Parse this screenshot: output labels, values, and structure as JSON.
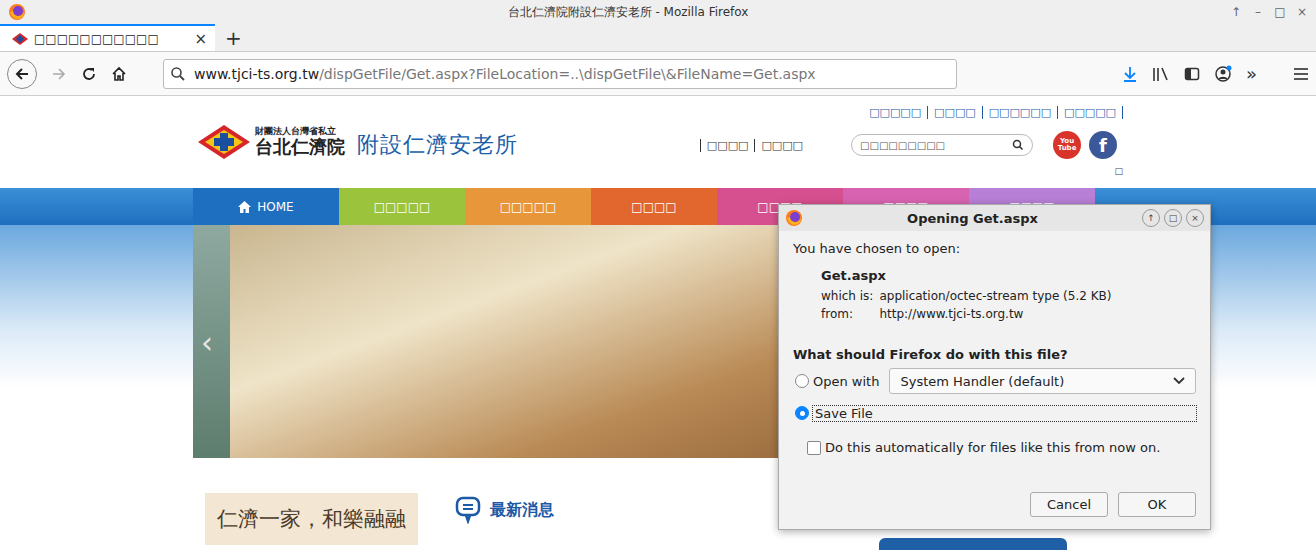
{
  "window": {
    "title": "台北仁濟院附設仁濟安老所 - Mozilla Firefox",
    "controls": [
      "↑",
      "–",
      "□",
      "×"
    ]
  },
  "tabs": [
    {
      "label": "□□□□□□□□□□□",
      "selected": true,
      "close": "×"
    }
  ],
  "new_tab": "+",
  "address_bar": {
    "host": "www.tjci-ts.org.tw",
    "path": "/dispGetFile/Get.aspx?FileLocation=..\\dispGetFile\\&FileName=Get.aspx"
  },
  "toolbar": {
    "overflow": "»"
  },
  "page": {
    "top_links": [
      "□□□□□",
      "□□□□",
      "□□□□□□",
      "□□□□□"
    ],
    "sub_links": [
      "□□□□",
      "□□□□"
    ],
    "search": {
      "placeholder": "□□□□□□□□□"
    },
    "logo": {
      "org": "財團法人台灣省私立",
      "name": "台北仁濟院",
      "subtitle": "附設仁濟安老所"
    },
    "social": {
      "youtube": "You Tube",
      "facebook": "f"
    },
    "corner_box": "□",
    "nav": [
      {
        "label": "HOME",
        "color": "#1f6fc0"
      },
      {
        "label": "□□□□□",
        "color": "#9bc43c"
      },
      {
        "label": "□□□□□",
        "color": "#e8963a"
      },
      {
        "label": "□□□□",
        "color": "#e2672e"
      },
      {
        "label": "□□□□",
        "color": "#d6508f"
      },
      {
        "label": "□□□□",
        "color": "#d763b0"
      },
      {
        "label": "□□□□",
        "color": "#b77fd6"
      }
    ],
    "carousel_prev": "‹",
    "slogan": "仁濟一家，和樂融融",
    "news_title": "最新消息"
  },
  "dialog": {
    "title": "Opening Get.aspx",
    "controls": [
      "↑",
      "□",
      "×"
    ],
    "intro": "You have chosen to open:",
    "filename": "Get.aspx",
    "details": [
      {
        "label": "which is:",
        "value": "application/octec-stream type (5.2 KB)"
      },
      {
        "label": "from:",
        "value": "http://www.tjci-ts.org.tw"
      }
    ],
    "question": "What should Firefox do with this file?",
    "options": [
      {
        "label": "Open with",
        "selected": false,
        "kind": "select",
        "value": "System Handler (default)"
      },
      {
        "label": "Save File",
        "selected": true,
        "kind": "plain",
        "value": ""
      }
    ],
    "remember": {
      "label": "Do this automatically for files like this from now on.",
      "checked": false
    },
    "buttons": [
      "Cancel",
      "OK"
    ]
  }
}
